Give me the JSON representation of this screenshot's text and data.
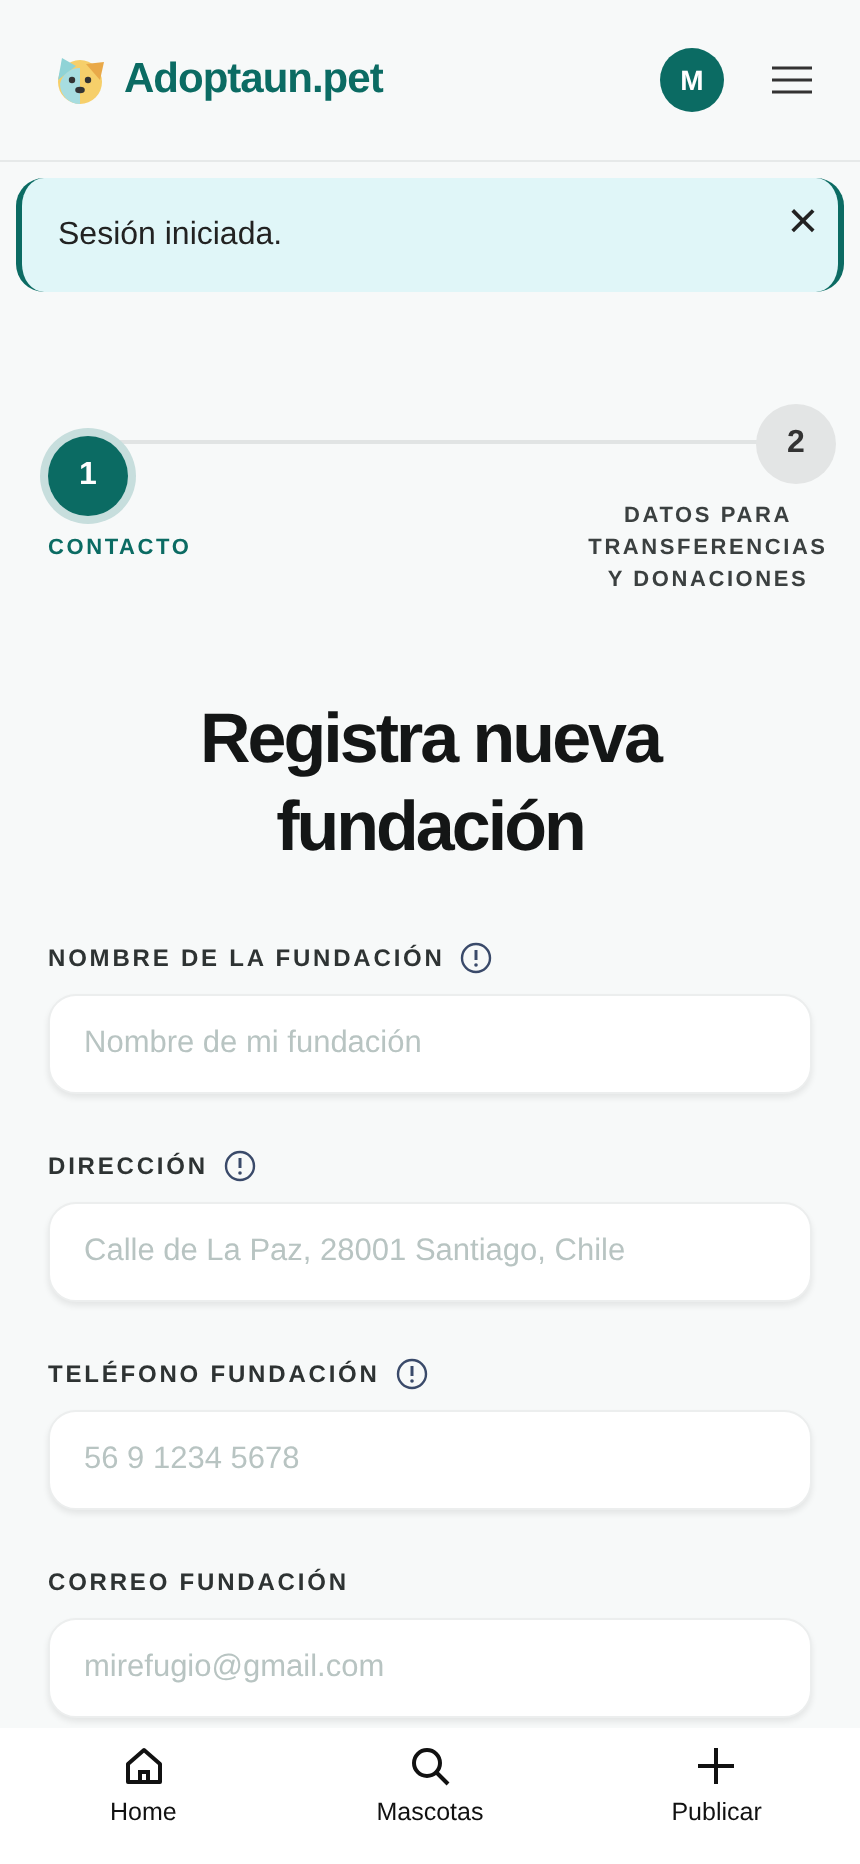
{
  "header": {
    "brand": "Adoptaun.pet",
    "avatar": "M"
  },
  "alert": {
    "message": "Sesión iniciada.",
    "close": "×"
  },
  "steps": [
    {
      "number": "1",
      "label": "CONTACTO",
      "selected": true
    },
    {
      "number": "2",
      "label": "DATOS PARA TRANSFERENCIAS Y DONACIONES",
      "selected": false
    }
  ],
  "title": "Registra nueva fundación",
  "fields": [
    {
      "label": "NOMBRE DE LA FUNDACIÓN",
      "info": true,
      "placeholder": "Nombre de mi fundación"
    },
    {
      "label": "DIRECCIÓN",
      "info": true,
      "placeholder": "Calle de La Paz, 28001 Santiago, Chile"
    },
    {
      "label": "TELÉFONO FUNDACIÓN",
      "info": true,
      "placeholder": "56 9 1234 5678"
    },
    {
      "label": "CORREO FUNDACIÓN",
      "info": false,
      "placeholder": "mirefugio@gmail.com"
    }
  ],
  "bottom_nav": [
    {
      "kind": "home",
      "label": "Home"
    },
    {
      "kind": "search",
      "label": "Mascotas"
    },
    {
      "kind": "add",
      "label": "Publicar"
    }
  ]
}
